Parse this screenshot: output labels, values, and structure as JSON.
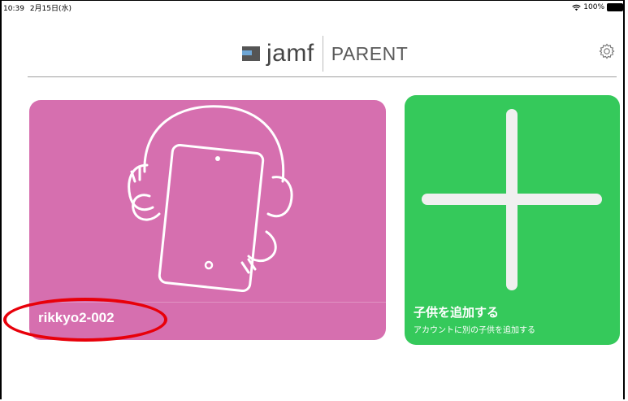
{
  "status_bar": {
    "time": "10:39",
    "date": "2月15日(水)",
    "battery": "100%"
  },
  "header": {
    "brand": "jamf",
    "product": "PARENT",
    "settings_icon": "gear-icon"
  },
  "children": [
    {
      "name": "rikkyo2-002",
      "icon": "child-ipad-headphones-illustration"
    }
  ],
  "add_child": {
    "title": "子供を追加する",
    "subtitle": "アカウントに別の子供を追加する",
    "icon": "plus-icon"
  },
  "colors": {
    "child_card": "#d66faf",
    "add_card": "#35c95b",
    "annotation": "#e8000a"
  }
}
